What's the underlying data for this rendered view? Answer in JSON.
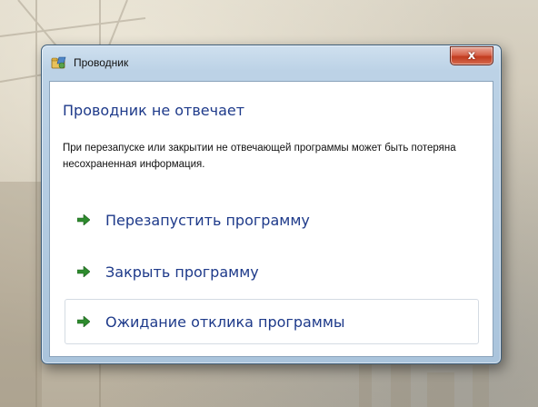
{
  "window": {
    "title": "Проводник",
    "close_label": "x"
  },
  "dialog": {
    "heading": "Проводник не отвечает",
    "message": "При перезапуске или закрытии не отвечающей программы может быть потеряна несохраненная информация.",
    "options": [
      {
        "label": "Перезапустить программу"
      },
      {
        "label": "Закрыть программу"
      },
      {
        "label": "Ожидание отклика программы"
      }
    ]
  },
  "colors": {
    "link_blue": "#1e3a8a",
    "arrow_green": "#2e8b2e",
    "close_red": "#c23b1f"
  },
  "icons": {
    "title_icon": "explorer-icon",
    "option_icon": "green-arrow-icon"
  }
}
